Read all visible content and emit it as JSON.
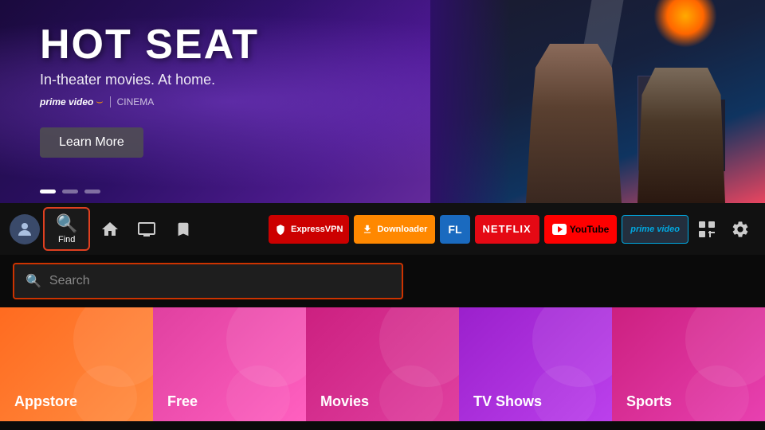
{
  "hero": {
    "title": "HOT SEAT",
    "subtitle": "In-theater movies. At home.",
    "brand_prime": "prime video",
    "brand_separator": "|",
    "brand_cinema": "CINEMA",
    "learn_more": "Learn More",
    "dot1_active": true,
    "dot2_active": false,
    "dot3_active": false
  },
  "navbar": {
    "find_label": "Find",
    "apps": [
      {
        "id": "expressvpn",
        "label": "ExpressVPN"
      },
      {
        "id": "downloader",
        "label": "Downloader"
      },
      {
        "id": "filelinked",
        "label": "FL"
      },
      {
        "id": "netflix",
        "label": "NETFLIX"
      },
      {
        "id": "youtube",
        "label": "YouTube"
      },
      {
        "id": "prime",
        "label": "prime video"
      }
    ]
  },
  "search": {
    "placeholder": "Search"
  },
  "categories": [
    {
      "id": "appstore",
      "label": "Appstore"
    },
    {
      "id": "free",
      "label": "Free"
    },
    {
      "id": "movies",
      "label": "Movies"
    },
    {
      "id": "tvshows",
      "label": "TV Shows"
    },
    {
      "id": "sports",
      "label": "Sports"
    }
  ]
}
